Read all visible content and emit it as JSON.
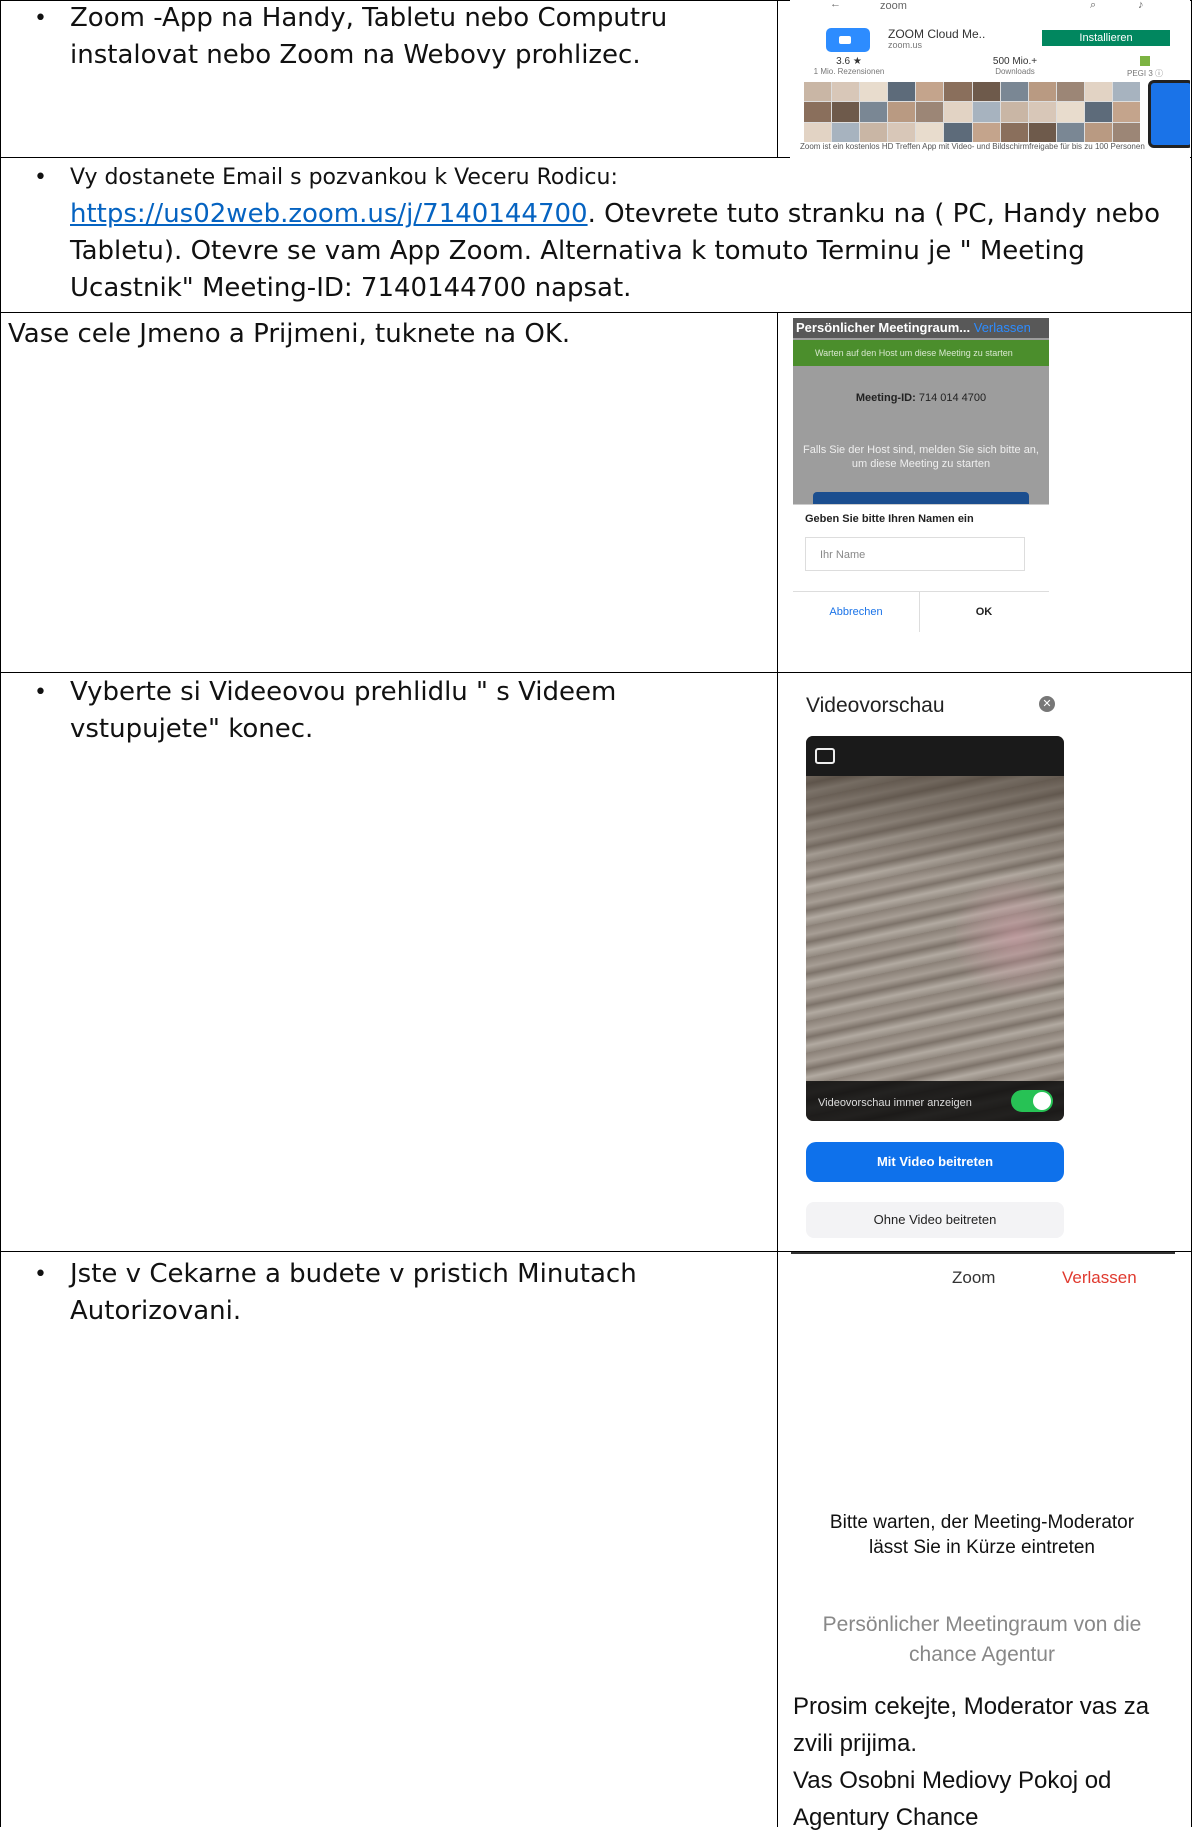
{
  "page_caption": "...",
  "rows": [
    {
      "bullet": "•",
      "text": "Zoom -App na Handy, Tabletu nebo Computru instalovat nebo Zoom na  Webovy prohlizec.",
      "image": {
        "status_bar": "zoom",
        "app_title": "ZOOM Cloud Me..",
        "app_sub": "zoom.us",
        "install_label": "Installieren",
        "stat1_value": "3.6 ★",
        "stat1_label": "1 Mio. Rezensionen",
        "stat2_value": "500 Mio.+",
        "stat2_label": "Downloads",
        "stat3_label": "PEGI 3 ⓘ",
        "description": "Zoom ist ein kostenlos HD Treffen App mit Video- und Bildschirmfreigabe für bis zu 100 Personen"
      }
    },
    {
      "bullet": "•",
      "pre": "Vy dostanete Email s pozvankou k Veceru Rodicu:",
      "link": "https://us02web.zoom.us/j/7140144700",
      "post": ". Otevrete tuto stranku na ( PC, Handy nebo Tabletu). Otevre se vam App Zoom. Alternativa k tomuto Terminu je \" Meeting Ucastnik\" Meeting-ID: 7140144700 napsat."
    },
    {
      "text": "Vase cele Jmeno a Prijmeni, tuknete na OK.",
      "image": {
        "header": "Persönlicher Meetingraum...",
        "header_link": "Verlassen",
        "wait_banner": "Warten auf den Host um diese Meeting zu starten",
        "meeting_id_label": "Meeting-ID:",
        "meeting_id_value": "714 014 4700",
        "info": "Falls Sie der Host sind, melden Sie sich bitte an, um diese Meeting zu starten",
        "dialog_title": "Geben Sie bitte Ihren Namen ein",
        "input_placeholder": "Ihr Name",
        "cancel": "Abbrechen",
        "ok": "OK"
      }
    },
    {
      "bullet": "•",
      "text": "Vyberte si Videeovou prehlidlu \" s Videem vstupujete\" konec.",
      "image": {
        "title": "Videovorschau",
        "toggle_label": "Videovorschau immer anzeigen",
        "toggle_on": true,
        "btn_with_video": "Mit Video beitreten",
        "btn_without_video": "Ohne Video beitreten"
      }
    },
    {
      "bullet": "•",
      "text": "Jste v Cekarne a budete v pristich Minutach Autorizovani.",
      "image": {
        "app_name": "Zoom",
        "leave": "Verlassen",
        "waiting": "Bitte warten, der Meeting-Moderator lässt Sie in Kürze eintreten",
        "room": "Persönlicher Meetingraum von die chance Agentur",
        "czech1": "Prosim cekejte, Moderator vas za zvili prijima.",
        "czech2": "Vas Osobni Mediovy Pokoj od Agentury Chance"
      }
    }
  ],
  "colors": {
    "link": "#0563c1",
    "zoom_blue": "#0e71eb",
    "install_green": "#01875f",
    "leave_red": "#e03a2f"
  }
}
